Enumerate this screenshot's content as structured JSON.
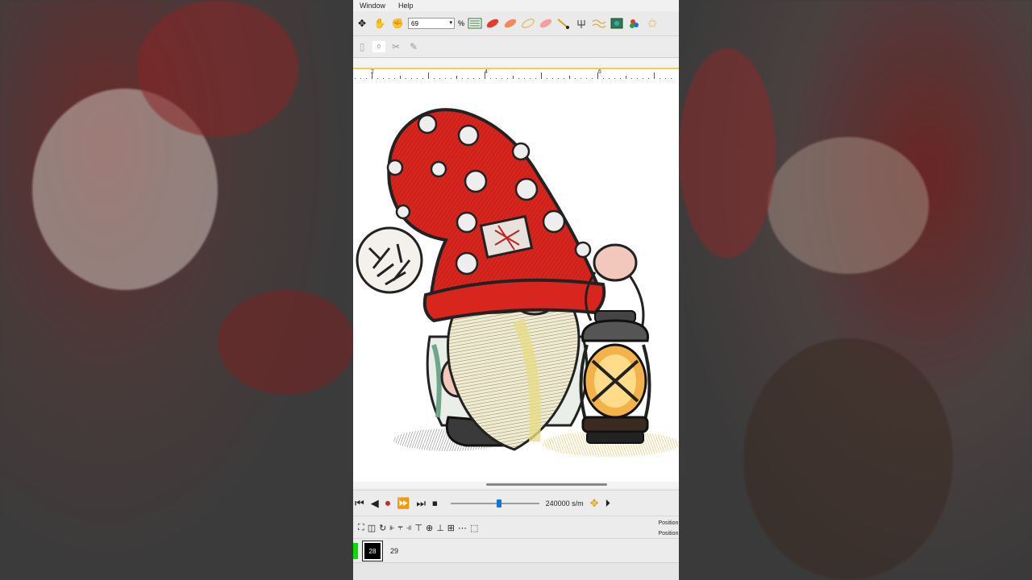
{
  "menu": {
    "window_label": "Window",
    "help_label": "Help"
  },
  "toolbar": {
    "zoom_value": "69",
    "zoom_unit": "%",
    "stitch_field_value": "0"
  },
  "ruler": {
    "labels": [
      "2",
      "4",
      "6"
    ]
  },
  "playback": {
    "speed_label": "240000 s/m",
    "progress": 0.55
  },
  "position": {
    "x_label": "Position X",
    "y_label": "Position Y"
  },
  "status": {
    "color_number": "28",
    "color_count": "29"
  },
  "colors": {
    "accent_green": "#00e000",
    "slider_blue": "#1d6fd8",
    "ruler_highlight": "#f3d24a"
  },
  "canvas": {
    "design": "embroidery-gnome-with-lantern"
  }
}
